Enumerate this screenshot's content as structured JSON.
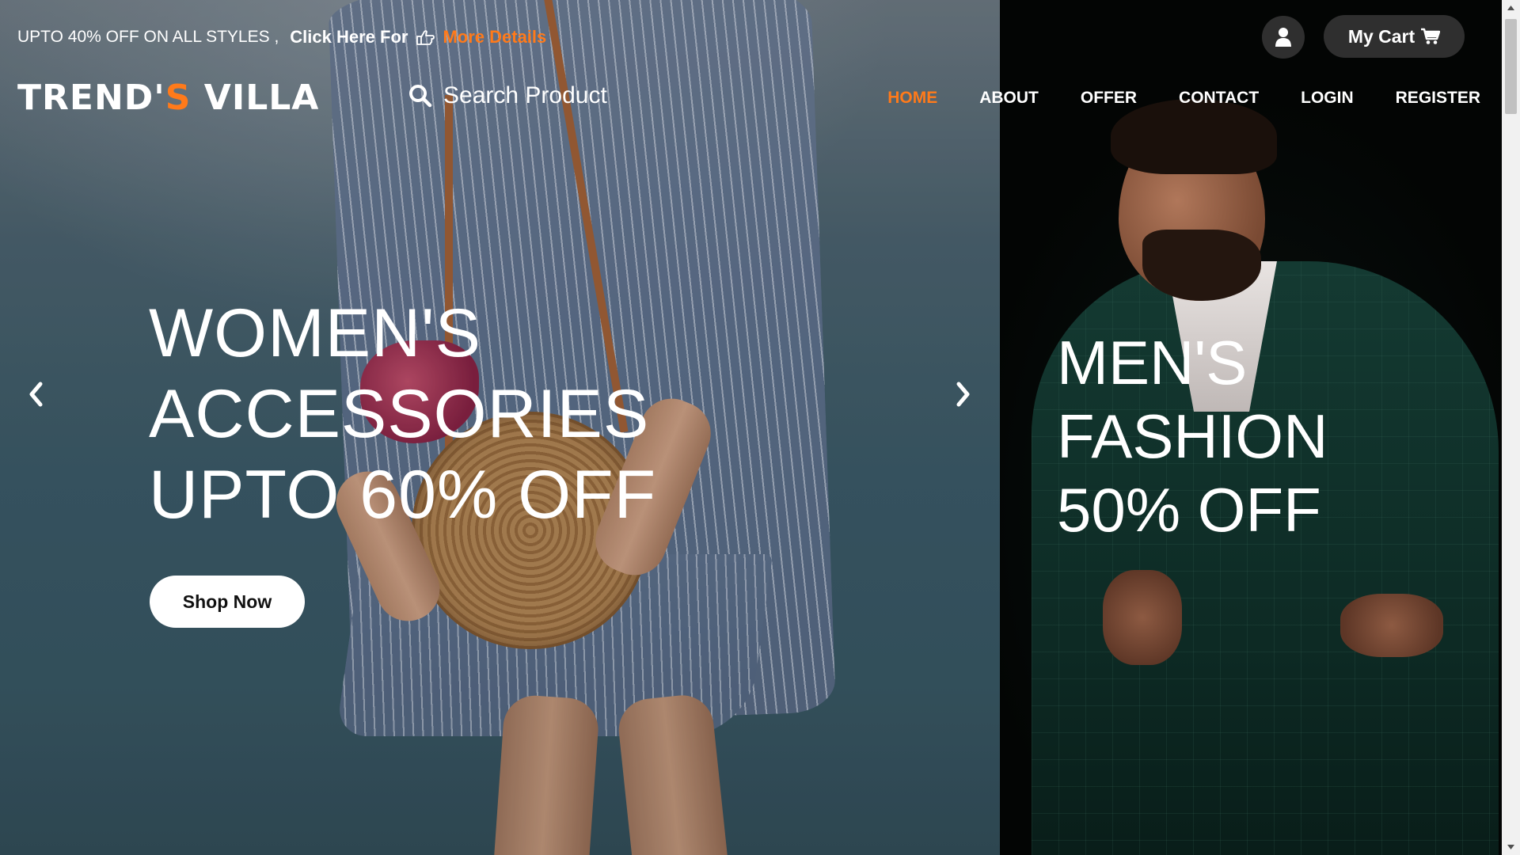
{
  "promo": {
    "text": "UPTO 40% OFF ON ALL STYLES ,",
    "cta_prefix": "Click Here For",
    "cta_link": "More Details"
  },
  "header": {
    "cart_label": "My Cart",
    "logo_part1": "TREND'",
    "logo_accent": "S",
    "logo_part2": " VILLA"
  },
  "search": {
    "placeholder": "Search Product"
  },
  "nav": {
    "items": [
      {
        "label": "HOME",
        "active": true
      },
      {
        "label": "ABOUT",
        "active": false
      },
      {
        "label": "OFFER",
        "active": false
      },
      {
        "label": "CONTACT",
        "active": false
      },
      {
        "label": "LOGIN",
        "active": false
      },
      {
        "label": "REGISTER",
        "active": false
      }
    ]
  },
  "slider": {
    "title_lines": [
      "WOMEN'S",
      "ACCESSORIES",
      "UPTO 60% OFF"
    ],
    "button_label": "Shop Now"
  },
  "side_banner": {
    "title_lines": [
      "MEN'S",
      "FASHION",
      "50% OFF"
    ]
  },
  "icons": {
    "pointer": "hand-pointer-icon",
    "user": "user-icon",
    "cart": "cart-icon",
    "search": "search-icon",
    "prev": "chevron-left-icon",
    "next": "chevron-right-icon"
  },
  "colors": {
    "accent": "#ff7a1a",
    "pill_background": "#2f2f2f",
    "text": "#ffffff"
  }
}
